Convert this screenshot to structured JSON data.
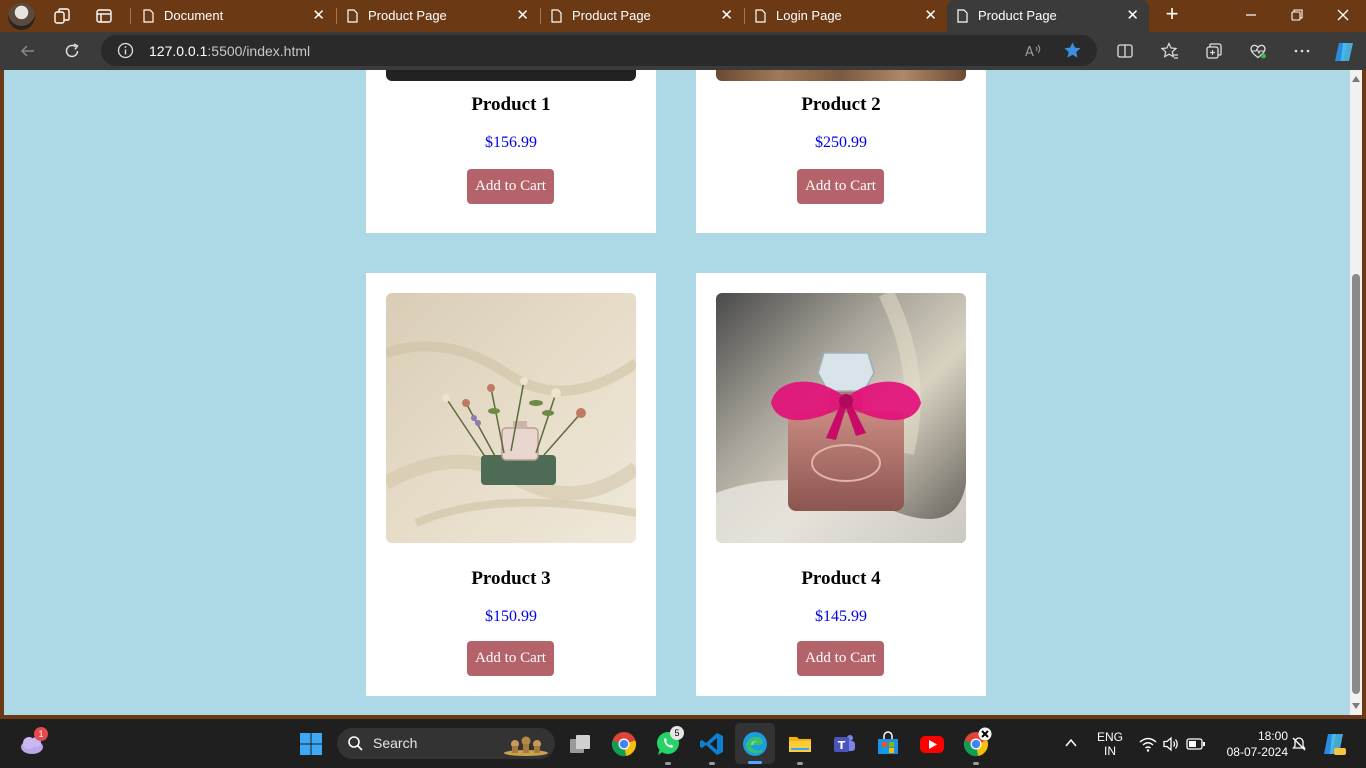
{
  "browser": {
    "tabs": [
      {
        "title": "Document",
        "active": false
      },
      {
        "title": "Product Page",
        "active": false
      },
      {
        "title": "Product Page",
        "active": false
      },
      {
        "title": "Login Page",
        "active": false
      },
      {
        "title": "Product Page",
        "active": true
      }
    ],
    "url_host": "127.0.0.1",
    "url_rest": ":5500/index.html"
  },
  "page": {
    "products": [
      {
        "name": "Product 1",
        "price": "$156.99",
        "button": "Add to Cart"
      },
      {
        "name": "Product 2",
        "price": "$250.99",
        "button": "Add to Cart"
      },
      {
        "name": "Product 3",
        "price": "$150.99",
        "button": "Add to Cart"
      },
      {
        "name": "Product 4",
        "price": "$145.99",
        "button": "Add to Cart"
      }
    ]
  },
  "taskbar": {
    "search_placeholder": "Search",
    "weather_badge": "1",
    "whatsapp_badge": "5",
    "language": "ENG",
    "region": "IN",
    "time": "18:00",
    "date": "08-07-2024"
  },
  "colors": {
    "tabstrip": "#6b3a14",
    "page_background": "#add8e6",
    "button": "#b5636a",
    "price": "#0000ee"
  }
}
